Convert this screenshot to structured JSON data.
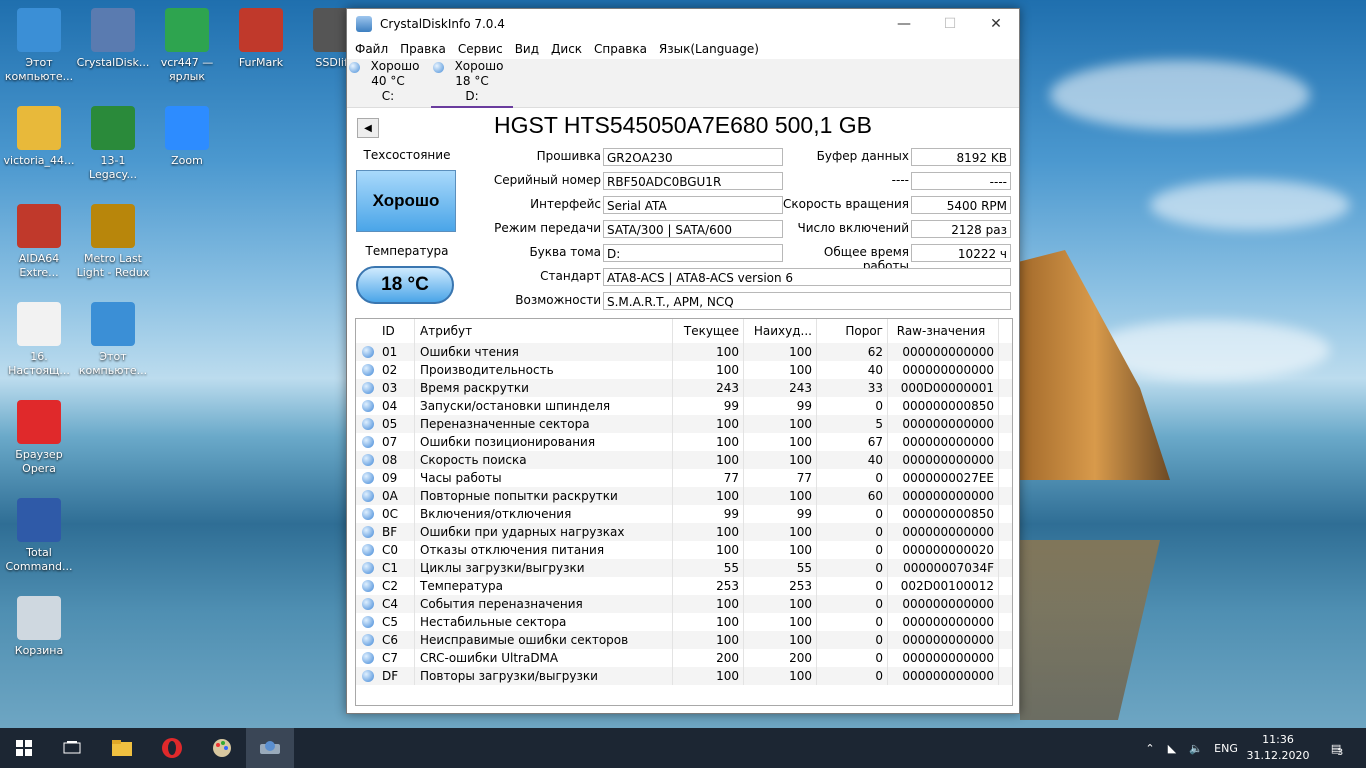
{
  "desktop_icons": [
    {
      "label": "Этот компьюте...",
      "icon": "computer-icon",
      "color": "#3b8fd6"
    },
    {
      "label": "CrystalDisk...",
      "icon": "crystaldisk-icon",
      "color": "#5a7bb0"
    },
    {
      "label": "vcr447 — ярлык",
      "icon": "green-plus-icon",
      "color": "#2ea44f"
    },
    {
      "label": "FurMark",
      "icon": "furmark-icon",
      "color": "#c0392b"
    },
    {
      "label": "SSDlife",
      "icon": "ssdlife-icon",
      "color": "#555555"
    },
    {
      "label": "victoria_44...",
      "icon": "folder-icon",
      "color": "#e8b93a"
    },
    {
      "label": "13-1 Legacy...",
      "icon": "legacy-icon",
      "color": "#2a8a3a"
    },
    {
      "label": "Zoom",
      "icon": "zoom-icon",
      "color": "#2d8cff"
    },
    {
      "label": "AIDA64 Extre...",
      "icon": "aida64-icon",
      "color": "#c0392b"
    },
    {
      "label": "Metro Last Light - Redux",
      "icon": "metro-icon",
      "color": "#b8860b"
    },
    {
      "label": "16. Настоящ...",
      "icon": "music-file-icon",
      "color": "#f2f2f2"
    },
    {
      "label": "Этот компьюте...",
      "icon": "computer-icon",
      "color": "#3b8fd6"
    },
    {
      "label": "Браузер Opera",
      "icon": "opera-icon",
      "color": "#e0292b"
    },
    {
      "label": "Total Command...",
      "icon": "floppy-icon",
      "color": "#2f5aa8"
    },
    {
      "label": "Корзина",
      "icon": "recycle-bin-icon",
      "color": "#cfd8e0"
    }
  ],
  "window": {
    "title": "CrystalDiskInfo 7.0.4",
    "minimize": "—",
    "maximize": "☐",
    "close": "✕"
  },
  "menu": [
    "Файл",
    "Правка",
    "Сервис",
    "Вид",
    "Диск",
    "Справка",
    "Язык(Language)"
  ],
  "drives": [
    {
      "status": "Хорошо",
      "temp": "40 °C",
      "letter": "C:"
    },
    {
      "status": "Хорошо",
      "temp": "18 °C",
      "letter": "D:"
    }
  ],
  "back_arrow": "◀",
  "model": "HGST HTS545050A7E680 500,1 GB",
  "health": {
    "title": "Техсостояние",
    "value": "Хорошо"
  },
  "temperature": {
    "title": "Температура",
    "value": "18 °C"
  },
  "info_left": [
    {
      "label": "Прошивка",
      "value": "GR2OA230"
    },
    {
      "label": "Серийный номер",
      "value": "RBF50ADC0BGU1R"
    },
    {
      "label": "Интерфейс",
      "value": "Serial ATA"
    },
    {
      "label": "Режим передачи",
      "value": "SATA/300 | SATA/600"
    },
    {
      "label": "Буква тома",
      "value": "D:"
    }
  ],
  "info_right": [
    {
      "label": "Буфер данных",
      "value": "8192 KB"
    },
    {
      "label": "----",
      "value": "----"
    },
    {
      "label": "Скорость вращения",
      "value": "5400 RPM"
    },
    {
      "label": "Число включений",
      "value": "2128 раз"
    },
    {
      "label": "Общее время работы",
      "value": "10222 ч"
    }
  ],
  "standard": {
    "label": "Стандарт",
    "value": "ATA8-ACS | ATA8-ACS version 6"
  },
  "features": {
    "label": "Возможности",
    "value": "S.M.A.R.T., APM, NCQ"
  },
  "smart_headers": [
    "ID",
    "Атрибут",
    "Текущее",
    "Наихуд...",
    "Порог",
    "Raw-значения"
  ],
  "smart_rows": [
    [
      "01",
      "Ошибки чтения",
      "100",
      "100",
      "62",
      "000000000000"
    ],
    [
      "02",
      "Производительность",
      "100",
      "100",
      "40",
      "000000000000"
    ],
    [
      "03",
      "Время раскрутки",
      "243",
      "243",
      "33",
      "000D00000001"
    ],
    [
      "04",
      "Запуски/остановки шпинделя",
      "99",
      "99",
      "0",
      "000000000850"
    ],
    [
      "05",
      "Переназначенные сектора",
      "100",
      "100",
      "5",
      "000000000000"
    ],
    [
      "07",
      "Ошибки позиционирования",
      "100",
      "100",
      "67",
      "000000000000"
    ],
    [
      "08",
      "Скорость поиска",
      "100",
      "100",
      "40",
      "000000000000"
    ],
    [
      "09",
      "Часы работы",
      "77",
      "77",
      "0",
      "0000000027EE"
    ],
    [
      "0A",
      "Повторные попытки раскрутки",
      "100",
      "100",
      "60",
      "000000000000"
    ],
    [
      "0C",
      "Включения/отключения",
      "99",
      "99",
      "0",
      "000000000850"
    ],
    [
      "BF",
      "Ошибки при ударных нагрузках",
      "100",
      "100",
      "0",
      "000000000000"
    ],
    [
      "C0",
      "Отказы отключения питания",
      "100",
      "100",
      "0",
      "000000000020"
    ],
    [
      "C1",
      "Циклы загрузки/выгрузки",
      "55",
      "55",
      "0",
      "00000007034F"
    ],
    [
      "C2",
      "Температура",
      "253",
      "253",
      "0",
      "002D00100012"
    ],
    [
      "C4",
      "События переназначения",
      "100",
      "100",
      "0",
      "000000000000"
    ],
    [
      "C5",
      "Нестабильные сектора",
      "100",
      "100",
      "0",
      "000000000000"
    ],
    [
      "C6",
      "Неисправимые ошибки секторов",
      "100",
      "100",
      "0",
      "000000000000"
    ],
    [
      "C7",
      "CRC-ошибки UltraDMA",
      "200",
      "200",
      "0",
      "000000000000"
    ],
    [
      "DF",
      "Повторы загрузки/выгрузки",
      "100",
      "100",
      "0",
      "000000000000"
    ]
  ],
  "taskbar": {
    "lang": "ENG",
    "time": "11:36",
    "date": "31.12.2020",
    "notifications": "3"
  }
}
